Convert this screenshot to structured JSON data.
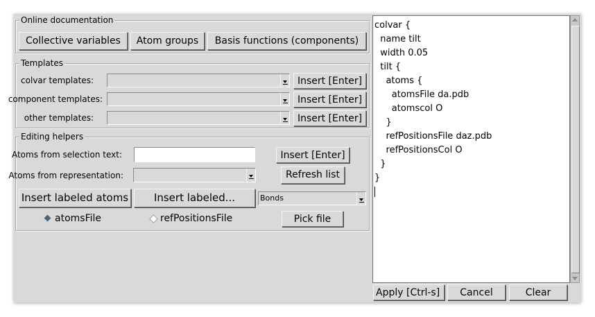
{
  "online_documentation": {
    "legend": "Online documentation",
    "buttons": [
      "Collective variables",
      "Atom groups",
      "Basis functions (components)"
    ]
  },
  "templates": {
    "legend": "Templates",
    "rows": [
      {
        "label": "colvar templates:",
        "insert": "Insert [Enter]"
      },
      {
        "label": "component templates:",
        "insert": "Insert [Enter]"
      },
      {
        "label": "other templates:",
        "insert": "Insert [Enter]"
      }
    ]
  },
  "editing_helpers": {
    "legend": "Editing helpers",
    "selection_label": "Atoms from selection text:",
    "selection_value": "",
    "insert_label": "Insert [Enter]",
    "representation_label": "Atoms from representation:",
    "refresh_label": "Refresh list",
    "insert_labeled_atoms": "Insert labeled atoms",
    "insert_labeled_dots": "Insert labeled...",
    "labeled_type": "Bonds",
    "radio_atoms_file": "atomsFile",
    "radio_ref_positions_file": "refPositionsFile",
    "radio_selected": "atomsFile",
    "pick_file": "Pick file"
  },
  "editor": {
    "lines": [
      "colvar {",
      "  name tilt",
      "  width 0.05",
      "  tilt {",
      "    atoms {",
      "      atomsFile da.pdb",
      "      atomscol O",
      "    }",
      "    refPositionsFile daz.pdb",
      "    refPositionsCol O",
      "  }",
      "}"
    ]
  },
  "bottom_buttons": {
    "apply": "Apply [Ctrl-s]",
    "cancel": "Cancel",
    "clear": "Clear"
  },
  "colors": {
    "window_bg": "#d9d9d9",
    "radio_selected": "#4a6478",
    "radio_unselected": "#ffffff"
  }
}
